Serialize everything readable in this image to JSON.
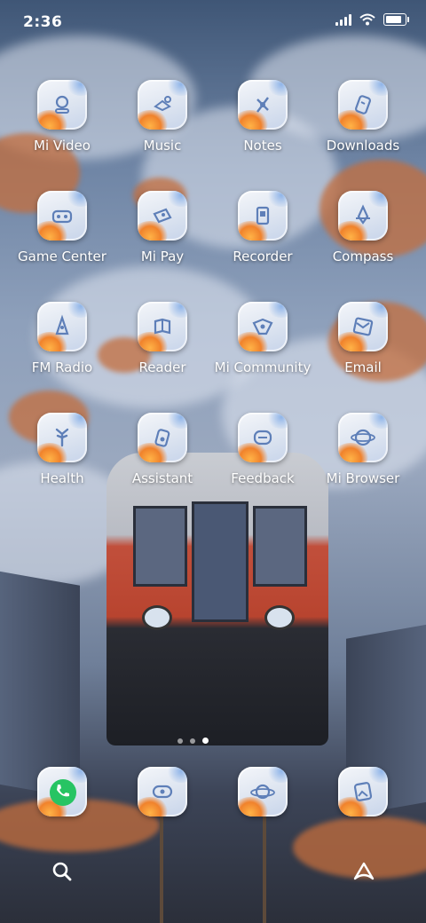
{
  "status_bar": {
    "time": "2:36"
  },
  "apps": [
    {
      "label": "Mi Video",
      "icon": "video-icon"
    },
    {
      "label": "Music",
      "icon": "music-icon"
    },
    {
      "label": "Notes",
      "icon": "notes-icon"
    },
    {
      "label": "Downloads",
      "icon": "downloads-icon"
    },
    {
      "label": "Game Center",
      "icon": "gamepad-icon"
    },
    {
      "label": "Mi Pay",
      "icon": "wallet-icon"
    },
    {
      "label": "Recorder",
      "icon": "recorder-icon"
    },
    {
      "label": "Compass",
      "icon": "compass-icon"
    },
    {
      "label": "FM Radio",
      "icon": "radio-icon"
    },
    {
      "label": "Reader",
      "icon": "book-icon"
    },
    {
      "label": "Mi Community",
      "icon": "community-icon"
    },
    {
      "label": "Email",
      "icon": "email-icon"
    },
    {
      "label": "Health",
      "icon": "health-icon"
    },
    {
      "label": "Assistant",
      "icon": "assistant-icon"
    },
    {
      "label": "Feedback",
      "icon": "feedback-icon"
    },
    {
      "label": "Mi Browser",
      "icon": "browser-icon"
    }
  ],
  "page_indicator": {
    "pages": 3,
    "active": 2
  },
  "dock": [
    {
      "name": "phone",
      "icon": "phone-icon"
    },
    {
      "name": "messages",
      "icon": "chat-icon"
    },
    {
      "name": "browser",
      "icon": "planet-icon"
    },
    {
      "name": "gallery",
      "icon": "gallery-icon"
    }
  ]
}
